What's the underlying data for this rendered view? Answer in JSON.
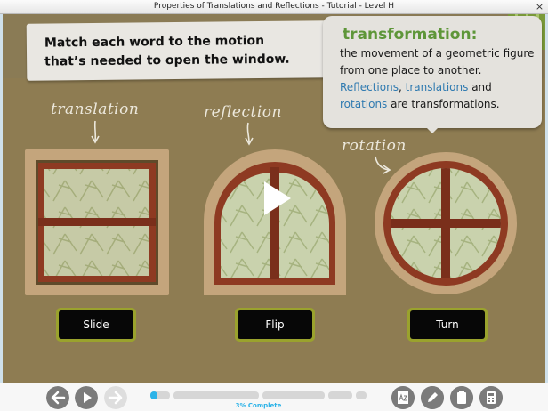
{
  "window": {
    "title": "Properties of Translations and Reflections - Tutorial - Level H",
    "close_glyph": "×"
  },
  "instruction": {
    "line1": "Match each word to the motion",
    "line2": "that’s needed to open the window."
  },
  "definition": {
    "term": "transformation:",
    "text_1": "the movement of a geometric figure from one place to another.",
    "link_1": "Reflections",
    "sep_1": ", ",
    "link_2": "translations",
    "text_2": " and",
    "link_3": "rotations",
    "text_3": " are transformations."
  },
  "labels": {
    "translation": "translation",
    "reflection": "reflection",
    "rotation": "rotation"
  },
  "buttons": {
    "slide": "Slide",
    "flip": "Flip",
    "turn": "Turn"
  },
  "toolbar": {
    "progress_percent": 3,
    "progress_label": "3% Complete",
    "icons": [
      "back-icon",
      "play-icon",
      "forward-icon",
      "glossary-icon",
      "pencil-icon",
      "clipboard-icon",
      "calculator-icon"
    ]
  },
  "colors": {
    "stage_background": "#8e7c52",
    "term_green": "#5e9639",
    "link_blue": "#2f7ab0",
    "button_border": "#9aa22d",
    "progress_blue": "#2cb3e8",
    "window_frame": "#c4a57c",
    "window_sash": "#8e3a22"
  }
}
